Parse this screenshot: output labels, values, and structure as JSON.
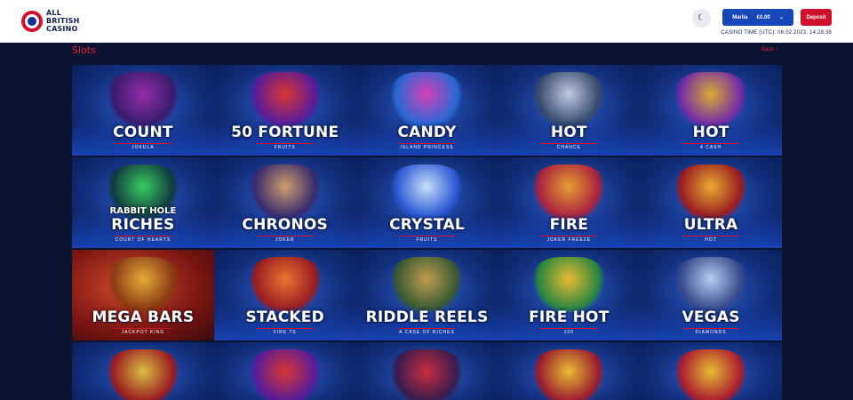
{
  "header": {
    "logo_line1": "ALL",
    "logo_line2": "BRITISH",
    "logo_line3": "CASINO",
    "theme_icon": "moon-icon",
    "user_name": "Mariia",
    "balance": "£0.00",
    "deposit_label": "Deposit",
    "casino_time": "CASINO TIME (UTC): 06.02.2023, 14:28:38"
  },
  "section": {
    "title": "Slots",
    "back_label": "Back"
  },
  "colors": {
    "brand_red": "#d0102a",
    "brand_blue": "#1746b8",
    "page_bg": "#0a1330"
  },
  "games": [
    {
      "title": "COUNT",
      "subtitle": "JOKULA"
    },
    {
      "title": "50 FORTUNE",
      "subtitle": "FRUITS"
    },
    {
      "title": "CANDY",
      "subtitle": "ISLAND PRINCESS"
    },
    {
      "title": "HOT",
      "subtitle": "CHANCE"
    },
    {
      "title": "HOT",
      "subtitle": "4 CASH"
    },
    {
      "pretitle": "RABBIT HOLE",
      "title": "RICHES",
      "subtitle": "COURT OF HEARTS"
    },
    {
      "title": "CHRONOS",
      "subtitle": "JOKER"
    },
    {
      "title": "CRYSTAL",
      "subtitle": "FRUITS"
    },
    {
      "title": "FIRE",
      "subtitle": "JOKER FREEZE"
    },
    {
      "title": "ULTRA",
      "subtitle": "HOT"
    },
    {
      "title": "MEGA BARS",
      "subtitle": "JACKPOT KING"
    },
    {
      "title": "STACKED",
      "subtitle": "FIRE 7S"
    },
    {
      "title": "RIDDLE REELS",
      "subtitle": "A CASE OF RICHES"
    },
    {
      "title": "FIRE HOT",
      "subtitle": "100"
    },
    {
      "title": "VEGAS",
      "subtitle": "DIAMONDS"
    }
  ]
}
